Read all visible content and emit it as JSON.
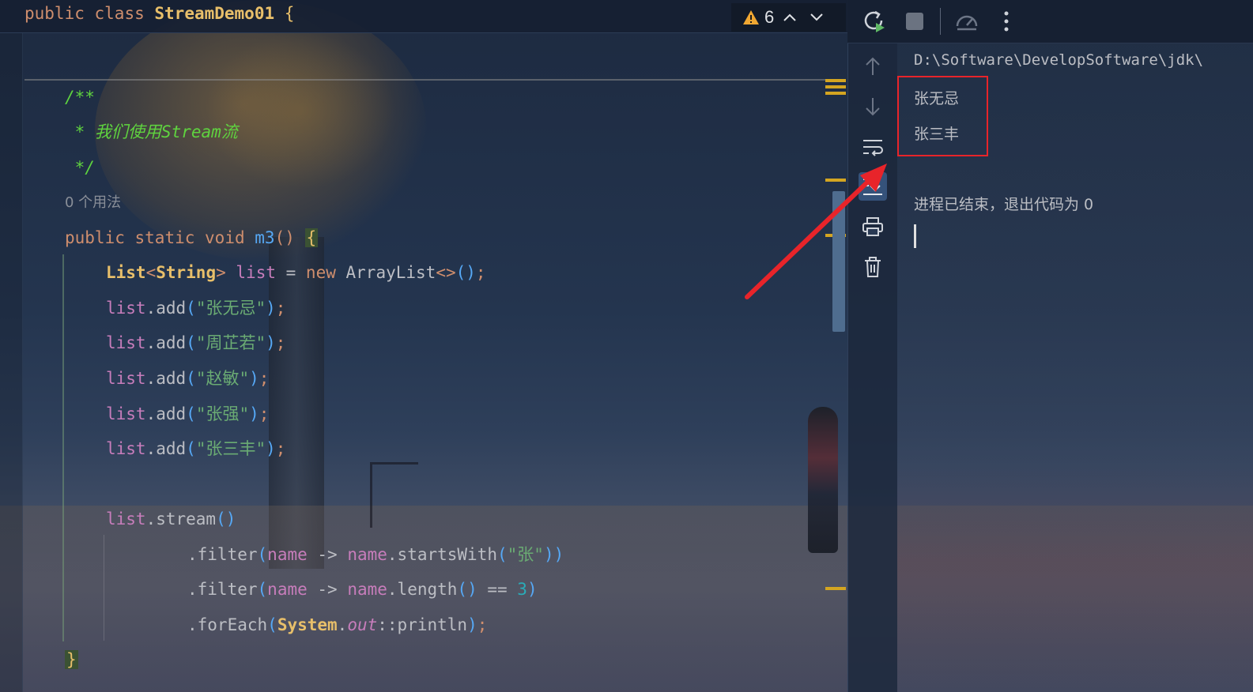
{
  "editor": {
    "sticky_header": {
      "kw1": "public",
      "kw2": "class",
      "class_name": "StreamDemo01",
      "brace": "{"
    },
    "inspection": {
      "warning_count": "6"
    },
    "doc_comment": {
      "open": "/**",
      "body": " * 我们使用Stream流",
      "close": " */"
    },
    "usage_hint": "0 个用法",
    "method_sig": {
      "kw1": "public",
      "kw2": "static",
      "kw3": "void",
      "name": "m3",
      "parens": "()",
      "brace": "{"
    },
    "list_decl": {
      "type1": "List",
      "lt": "<",
      "type2": "String",
      "gt": ">",
      "var": "list",
      "eq": " = ",
      "kw": "new",
      "ctor": "ArrayList",
      "diamond": "<>",
      "call": "()",
      "semi": ";"
    },
    "adds": [
      {
        "var": "list",
        "method": ".add",
        "open": "(",
        "arg": "\"张无忌\"",
        "close": ")",
        "semi": ";"
      },
      {
        "var": "list",
        "method": ".add",
        "open": "(",
        "arg": "\"周芷若\"",
        "close": ")",
        "semi": ";"
      },
      {
        "var": "list",
        "method": ".add",
        "open": "(",
        "arg": "\"赵敏\"",
        "close": ")",
        "semi": ";"
      },
      {
        "var": "list",
        "method": ".add",
        "open": "(",
        "arg": "\"张强\"",
        "close": ")",
        "semi": ";"
      },
      {
        "var": "list",
        "method": ".add",
        "open": "(",
        "arg": "\"张三丰\"",
        "close": ")",
        "semi": ";"
      }
    ],
    "stream_line": {
      "var": "list",
      "method": ".stream",
      "parens": "()"
    },
    "filter1": {
      "method": ".filter",
      "open": "(",
      "param": "name",
      "arrow": " -> ",
      "ref": "name",
      "call": ".startsWith",
      "copen": "(",
      "arg": "\"张\"",
      "cclose": ")",
      "close": ")"
    },
    "filter2": {
      "method": ".filter",
      "open": "(",
      "param": "name",
      "arrow": " -> ",
      "ref": "name",
      "call": ".length",
      "parens": "()",
      "op": " == ",
      "num": "3",
      "close": ")"
    },
    "foreach": {
      "method": ".forEach",
      "open": "(",
      "cls": "System",
      "dot": ".",
      "field": "out",
      "ref": "::println",
      "close": ")",
      "semi": ";"
    },
    "closing_brace": "}"
  },
  "console": {
    "path": "D:\\Software\\DevelopSoftware\\jdk\\",
    "output": [
      "张无忌",
      "张三丰"
    ],
    "exit_message": "进程已结束，退出代码为 0"
  },
  "colors": {
    "keyword": "#cf8e6d",
    "type": "#e8bf6a",
    "variable": "#c77dbb",
    "string": "#6aab73",
    "doc_comment": "#5fd33f",
    "number": "#2aacb8",
    "annotation_red": "#e8242a"
  },
  "icons": {
    "toolbar": [
      "rerun-icon",
      "stop-icon",
      "profiler-icon",
      "more-icon"
    ],
    "side": [
      "up-arrow-icon",
      "down-arrow-icon",
      "soft-wrap-icon",
      "scroll-to-end-icon",
      "print-icon",
      "trash-icon"
    ]
  }
}
